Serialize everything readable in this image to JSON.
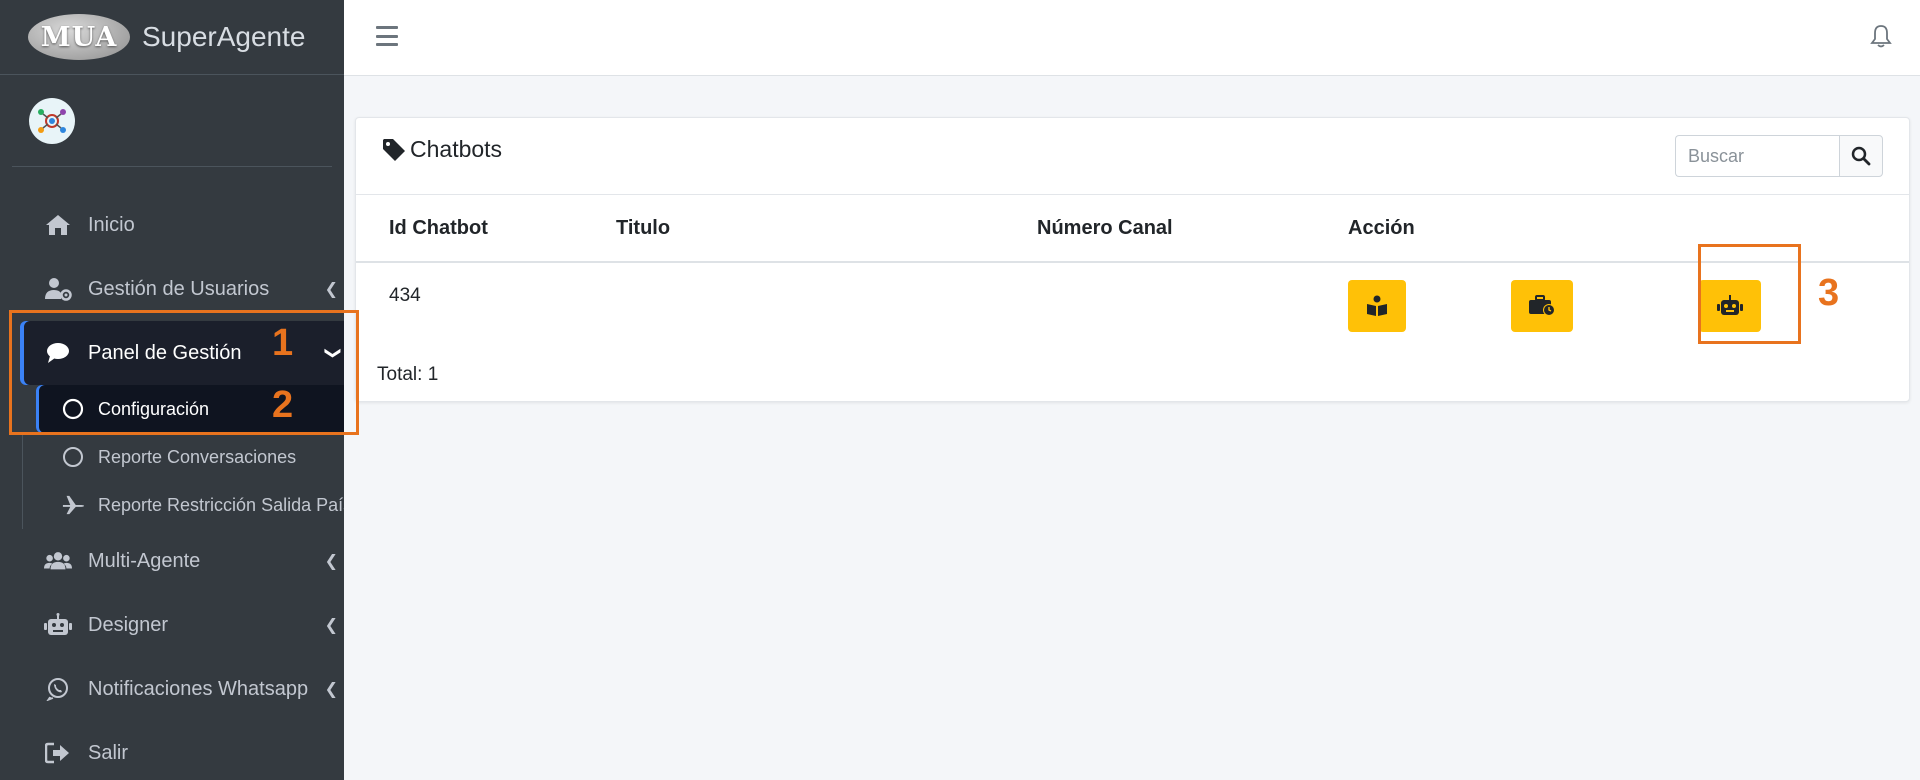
{
  "brand": {
    "logo_text": "MUA",
    "name": "SuperAgente"
  },
  "sidebar": {
    "items": [
      {
        "label": "Inicio",
        "icon": "home-icon"
      },
      {
        "label": "Gestión de Usuarios",
        "icon": "user-cog-icon"
      },
      {
        "label": "Panel de Gestión",
        "icon": "comment-icon",
        "active": true
      },
      {
        "label": "Multi-Agente",
        "icon": "users-icon"
      },
      {
        "label": "Designer",
        "icon": "robot-icon"
      },
      {
        "label": "Notificaciones Whatsapp",
        "icon": "whatsapp-icon"
      },
      {
        "label": "Salir",
        "icon": "sign-out-icon"
      }
    ],
    "subitems": [
      {
        "label": "Configuración",
        "icon": "circle-icon",
        "active": true
      },
      {
        "label": "Reporte Conversaciones",
        "icon": "circle-icon"
      },
      {
        "label": "Reporte Restricción Salida País",
        "icon": "plane-icon"
      }
    ]
  },
  "card": {
    "title": "Chatbots",
    "search_placeholder": "Buscar",
    "columns": [
      "Id Chatbot",
      "Titulo",
      "Número Canal",
      "Acción"
    ],
    "rows": [
      {
        "id": "434",
        "titulo": "",
        "numero_canal": ""
      }
    ],
    "total": "Total: 1"
  },
  "annotations": [
    "1",
    "2",
    "3"
  ],
  "colors": {
    "sidebar_bg": "#343a40",
    "active_bg": "#1b1f2b",
    "accent": "#3b82f6",
    "warning": "#ffc107",
    "annotation": "#e8731e"
  }
}
